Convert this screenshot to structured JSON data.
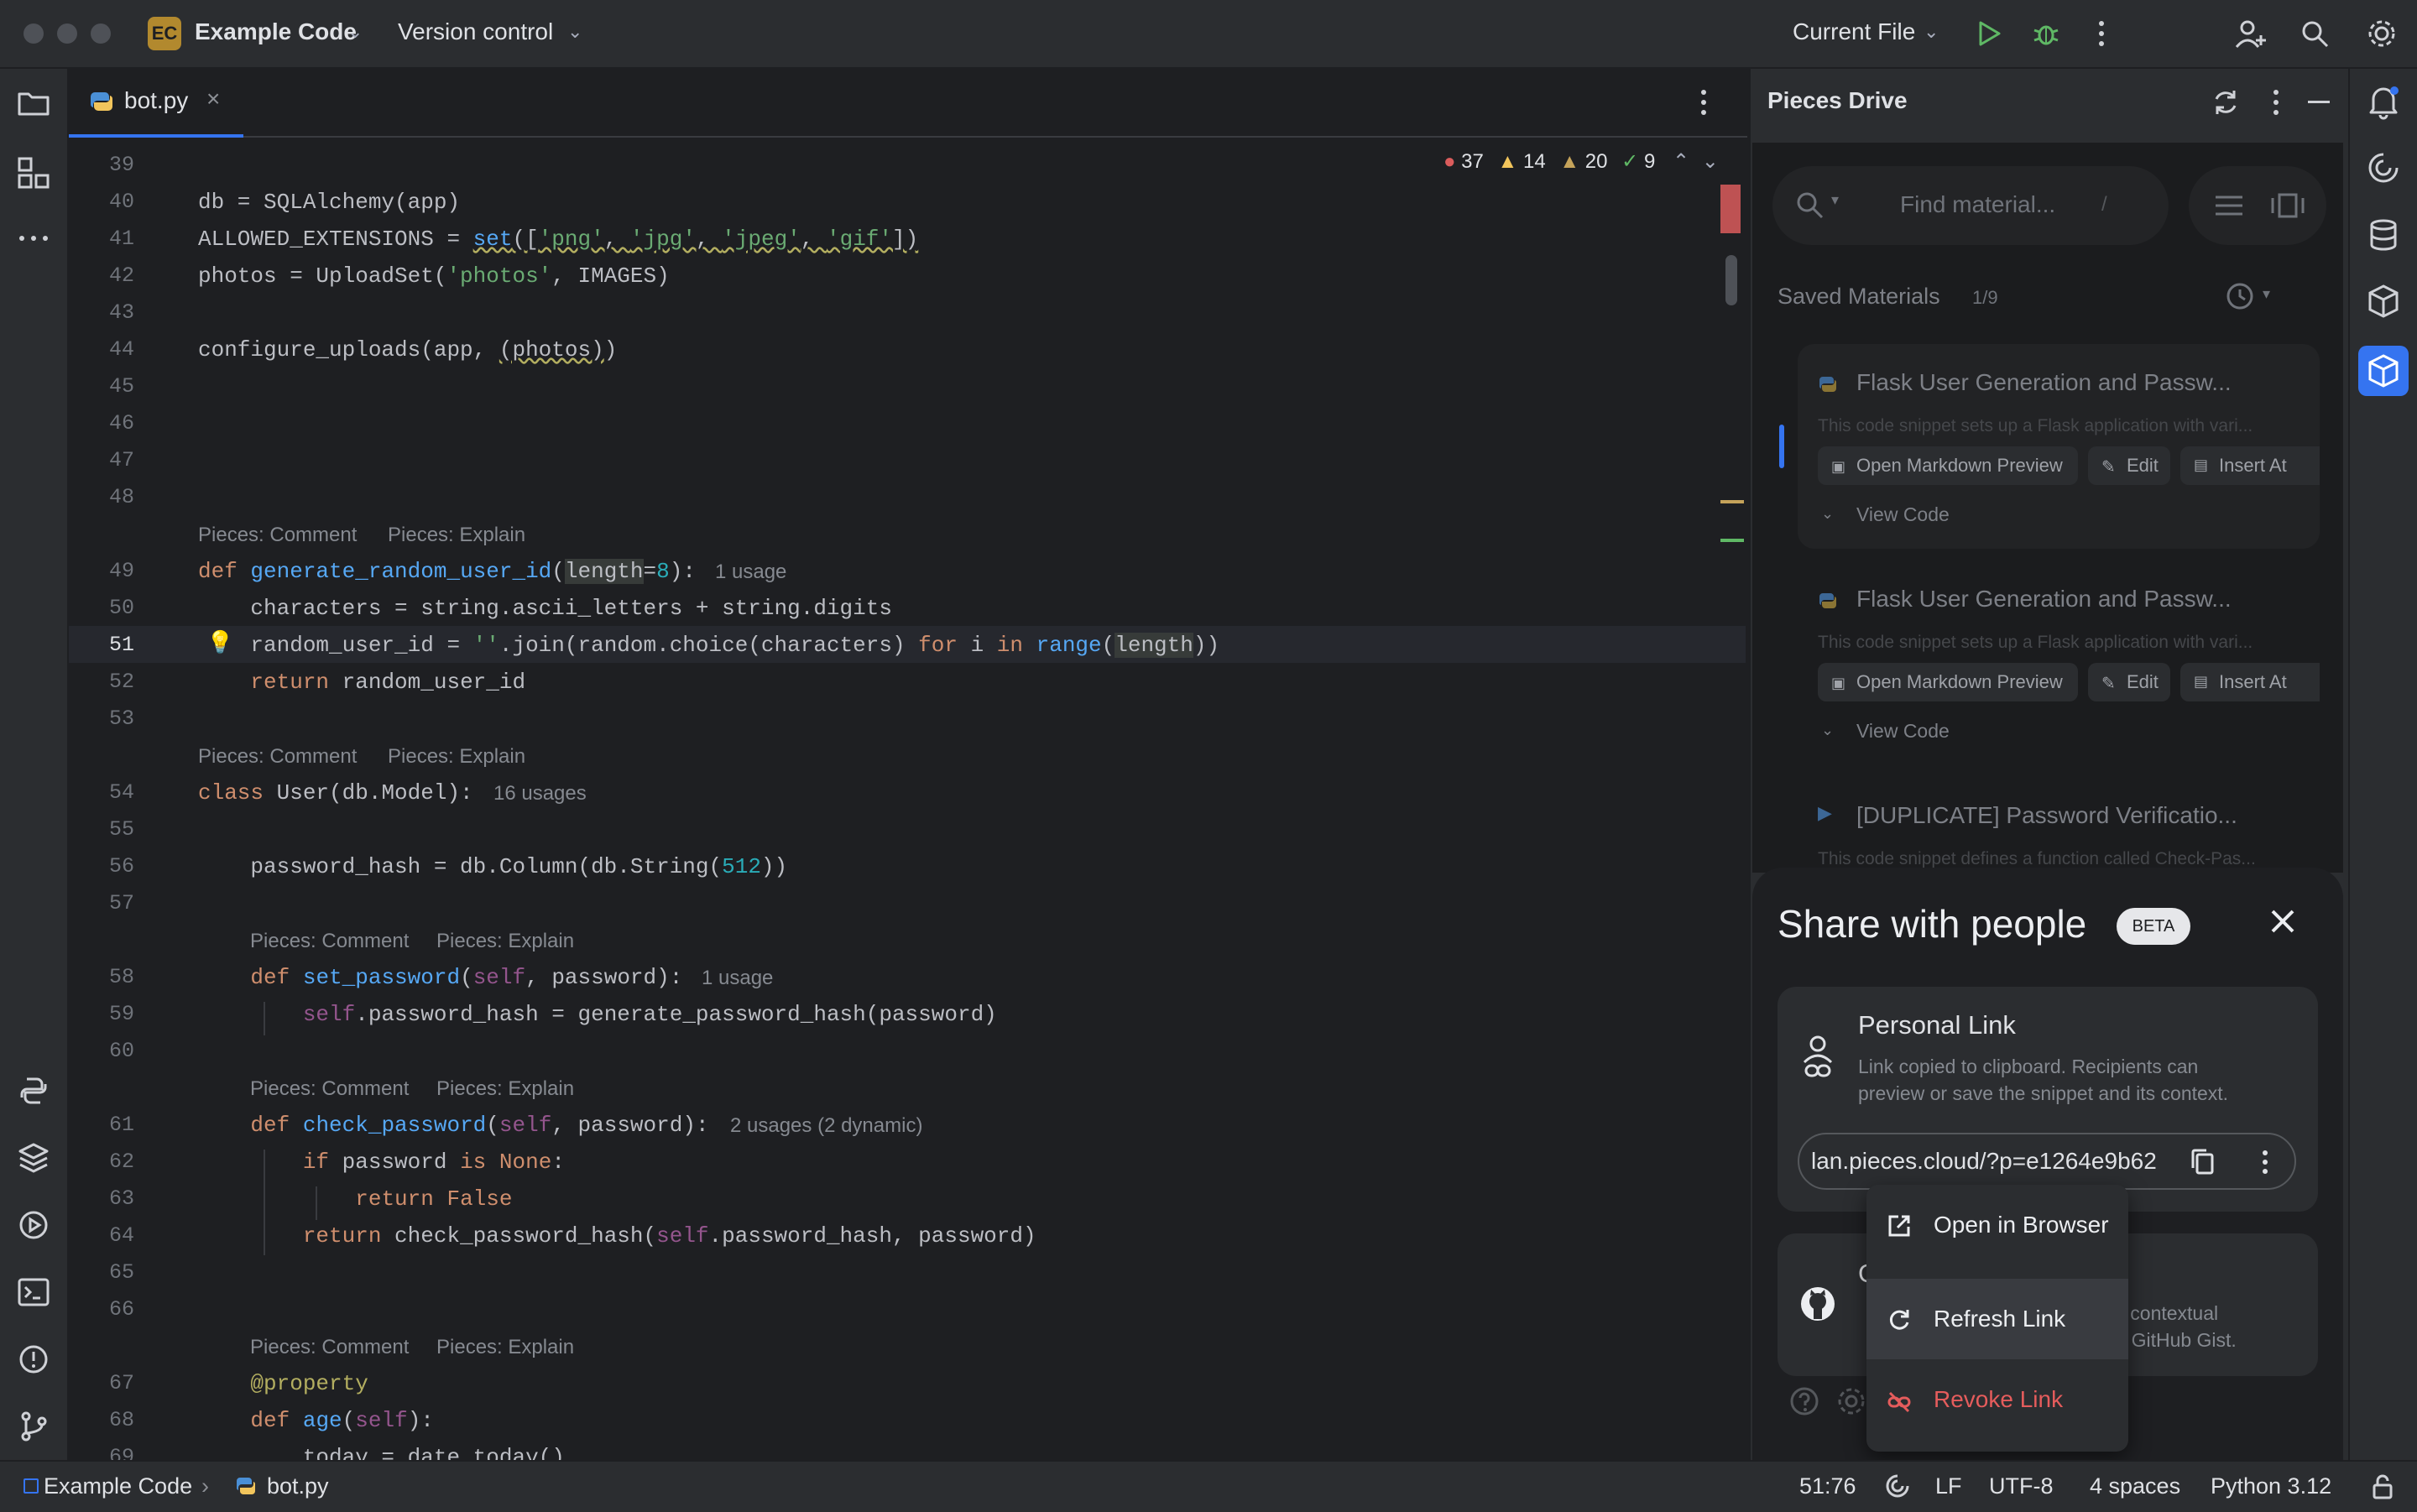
{
  "titlebar": {
    "project_badge": "EC",
    "project_name": "Example Code",
    "vcs": "Version control",
    "run_config": "Current File"
  },
  "editor": {
    "tab_name": "bot.py",
    "inspections": {
      "errors": "37",
      "warnings": "14",
      "weak_warnings": "20",
      "ok": "9"
    },
    "lines": [
      {
        "n": "39"
      },
      {
        "n": "40"
      },
      {
        "n": "41"
      },
      {
        "n": "42"
      },
      {
        "n": "43"
      },
      {
        "n": "44"
      },
      {
        "n": "45"
      },
      {
        "n": "46"
      },
      {
        "n": "47"
      },
      {
        "n": "48"
      },
      {
        "n": "49"
      },
      {
        "n": "50"
      },
      {
        "n": "51"
      },
      {
        "n": "52"
      },
      {
        "n": "53"
      },
      {
        "n": "54"
      },
      {
        "n": "55"
      },
      {
        "n": "56"
      },
      {
        "n": "57"
      },
      {
        "n": "58"
      },
      {
        "n": "59"
      },
      {
        "n": "60"
      },
      {
        "n": "61"
      },
      {
        "n": "62"
      },
      {
        "n": "63"
      },
      {
        "n": "64"
      },
      {
        "n": "65"
      },
      {
        "n": "66"
      },
      {
        "n": "67"
      },
      {
        "n": "68"
      },
      {
        "n": "69"
      }
    ],
    "code": {
      "l40": "db = SQLAlchemy(app)",
      "l41a": "ALLOWED_EXTENSIONS = ",
      "l41b": "set",
      "l41c": "([",
      "l41d": "'png'",
      "l41e": ", ",
      "l41f": "'jpg'",
      "l41g": "'jpeg'",
      "l41h": "'gif'",
      "l41i": "])",
      "l42a": "photos = UploadSet(",
      "l42b": "'photos'",
      "l42c": ", IMAGES)",
      "l44a": "configure_uploads(app, ",
      "l44b": "(photos)",
      "l44c": ")",
      "l49a": "def ",
      "l49b": "generate_random_user_id",
      "l49c": "(",
      "l49d": "length",
      "l49e": "=",
      "l49f": "8",
      "l49g": "):",
      "l49_usage": "1 usage",
      "l50": "    characters = string.ascii_letters + string.digits",
      "l51a": "    random_user_id = ",
      "l51b": "''",
      "l51c": ".join(random.choice(characters) ",
      "l51d": "for",
      "l51e": " i ",
      "l51f": "in",
      "l51g": " ",
      "l51h": "range",
      "l51i": "(",
      "l51j": "length",
      "l51k": "))",
      "l52a": "    ",
      "l52b": "return",
      "l52c": " random_user_id",
      "l54a": "class ",
      "l54b": "User(db.Model):",
      "l54_usage": "16 usages",
      "l56a": "    password_hash = db.Column(db.String(",
      "l56b": "512",
      "l56c": "))",
      "l58a": "    ",
      "l58b": "def ",
      "l58c": "set_password",
      "l58d": "(",
      "l58e": "self",
      "l58f": ", password):",
      "l58_usage": "1 usage",
      "l59a": "        ",
      "l59b": "self",
      "l59c": ".password_hash = generate_password_hash(password)",
      "l61a": "    ",
      "l61b": "def ",
      "l61c": "check_password",
      "l61d": "(",
      "l61e": "self",
      "l61f": ", password):",
      "l61_usage": "2 usages (2 dynamic)",
      "l62a": "        ",
      "l62b": "if",
      "l62c": " password ",
      "l62d": "is",
      "l62e": " ",
      "l62f": "None",
      "l62g": ":",
      "l63a": "            ",
      "l63b": "return",
      "l63c": " ",
      "l63d": "False",
      "l64a": "        ",
      "l64b": "return",
      "l64c": " check_password_hash(",
      "l64d": "self",
      "l64e": ".password_hash, password)",
      "l67a": "    ",
      "l67b": "@property",
      "l68a": "    ",
      "l68b": "def ",
      "l68c": "age",
      "l68d": "(",
      "l68e": "self",
      "l68f": "):",
      "l69": "        today = date.today()"
    },
    "codelens_comment": "Pieces: Comment",
    "codelens_explain": "Pieces: Explain"
  },
  "pieces": {
    "title": "Pieces Drive",
    "search_placeholder": "Find material...",
    "search_shortcut": "/",
    "saved_label": "Saved Materials",
    "saved_count": "1/9",
    "items": [
      {
        "title": "Flask User Generation and Passw...",
        "desc": "This code snippet sets up a Flask application with vari...",
        "open_md": "Open Markdown Preview",
        "edit": "Edit",
        "insert": "Insert At",
        "view_code": "View Code"
      },
      {
        "title": "Flask User Generation and Passw...",
        "desc": "This code snippet sets up a Flask application with vari...",
        "open_md": "Open Markdown Preview",
        "edit": "Edit",
        "insert": "Insert At",
        "view_code": "View Code"
      },
      {
        "title": "[DUPLICATE] Password Verificatio...",
        "desc": "This code snippet defines a function called Check-Pas..."
      }
    ],
    "share": {
      "title": "Share with people",
      "badge": "BETA",
      "personal_title": "Personal Link",
      "personal_desc_1": "Link copied to clipboard. Recipients can",
      "personal_desc_2": "preview or save the snippet and its context.",
      "link": "lan.pieces.cloud/?p=e1264e9b62",
      "gist_title": "G",
      "gist_desc_1": "ts contextual",
      "gist_desc_2": "te GitHub Gist.",
      "menu": {
        "open_browser": "Open in Browser",
        "refresh": "Refresh Link",
        "revoke": "Revoke Link"
      }
    }
  },
  "statusbar": {
    "project": "Example Code",
    "file": "bot.py",
    "position": "51:76",
    "line_sep": "LF",
    "encoding": "UTF-8",
    "indent": "4 spaces",
    "interpreter": "Python 3.12"
  },
  "colors": {
    "accent": "#3574f0",
    "run_green": "#5fb865",
    "error_red": "#db5c5c",
    "warning_yellow": "#f2c55c",
    "revoke_red": "#e55c5c"
  }
}
